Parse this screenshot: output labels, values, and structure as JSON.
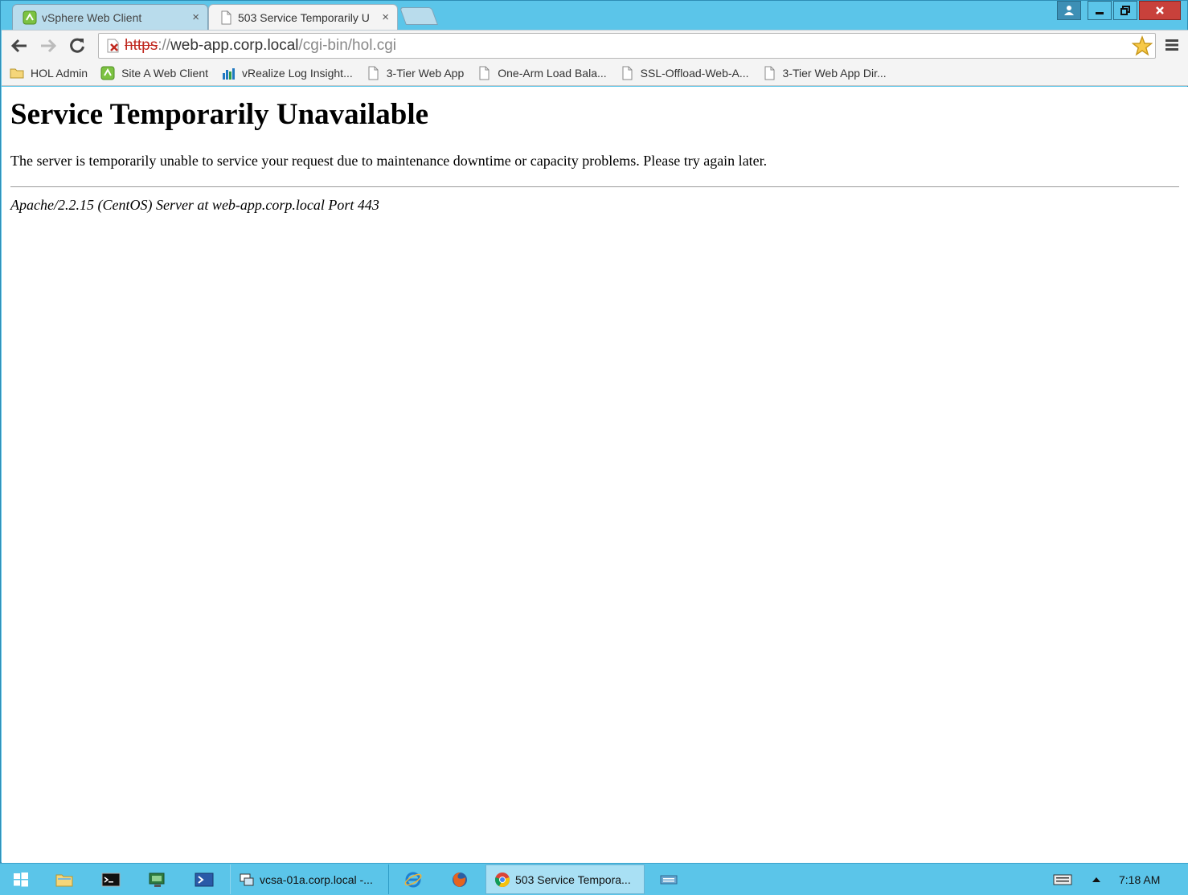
{
  "browser": {
    "tabs": [
      {
        "title": "vSphere Web Client",
        "icon": "vsphere-icon",
        "active": false
      },
      {
        "title": "503 Service Temporarily U",
        "icon": "page-icon",
        "active": true
      }
    ],
    "close_glyph": "×",
    "address": {
      "scheme": "https",
      "separator": "://",
      "host": "web-app.corp.local",
      "path": "/cgi-bin/hol.cgi"
    },
    "bookmarks": [
      {
        "label": "HOL Admin",
        "icon": "folder-icon"
      },
      {
        "label": "Site A Web Client",
        "icon": "vsphere-icon"
      },
      {
        "label": "vRealize Log Insight...",
        "icon": "bar-chart-icon"
      },
      {
        "label": "3-Tier Web App",
        "icon": "page-icon"
      },
      {
        "label": "One-Arm Load Bala...",
        "icon": "page-icon"
      },
      {
        "label": "SSL-Offload-Web-A...",
        "icon": "page-icon"
      },
      {
        "label": "3-Tier Web App Dir...",
        "icon": "page-icon"
      }
    ]
  },
  "page": {
    "heading": "Service Temporarily Unavailable",
    "message": "The server is temporarily unable to service your request due to maintenance downtime or capacity problems. Please try again later.",
    "signature": "Apache/2.2.15 (CentOS) Server at web-app.corp.local Port 443"
  },
  "taskbar": {
    "tasks": [
      {
        "label": "vcsa-01a.corp.local -...",
        "icon": "remote-desktop-icon"
      },
      {
        "label": "503 Service Tempora...",
        "icon": "chrome-icon",
        "active": true
      }
    ],
    "clock": "7:18 AM"
  },
  "colors": {
    "window_frame": "#5bc5e9",
    "close_button": "#c8413b",
    "insecure_scheme": "#c0281f"
  }
}
